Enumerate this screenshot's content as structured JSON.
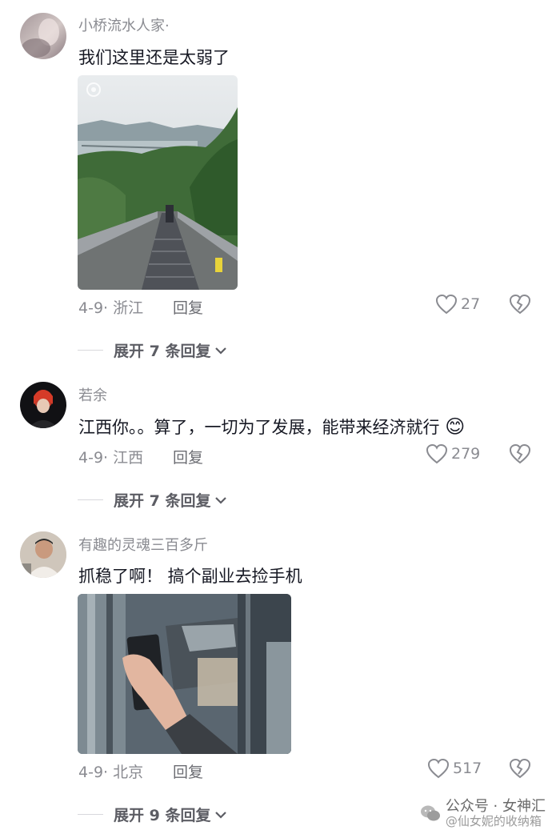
{
  "comments": [
    {
      "username": "小桥流水人家·",
      "text": "我们这里还是太弱了",
      "date_location": "4-9· 浙江",
      "reply_label": "回复",
      "likes": "27",
      "expand_label": "展开 7 条回复",
      "has_emoji": false
    },
    {
      "username": "若余",
      "text": "江西你。。算了，一切为了发展，能带来经济就行",
      "date_location": "4-9· 江西",
      "reply_label": "回复",
      "likes": "279",
      "expand_label": "展开 7 条回复",
      "has_emoji": true,
      "emoji": "😊"
    },
    {
      "username": "有趣的灵魂三百多斤",
      "text": "抓稳了啊！ 搞个副业去捡手机",
      "date_location": "4-9· 北京",
      "reply_label": "回复",
      "likes": "517",
      "expand_label": "展开 9 条回复",
      "has_emoji": false
    }
  ],
  "icons": {
    "like": "heart-outline-icon",
    "dislike": "broken-heart-icon",
    "expand": "chevron-down-icon"
  },
  "watermark": {
    "text": "公众号 · 女神汇",
    "subtext": "@仙女妮的收纳箱"
  },
  "colors": {
    "text_primary": "#161823",
    "text_secondary": "#8a8b91",
    "background": "#ffffff"
  }
}
